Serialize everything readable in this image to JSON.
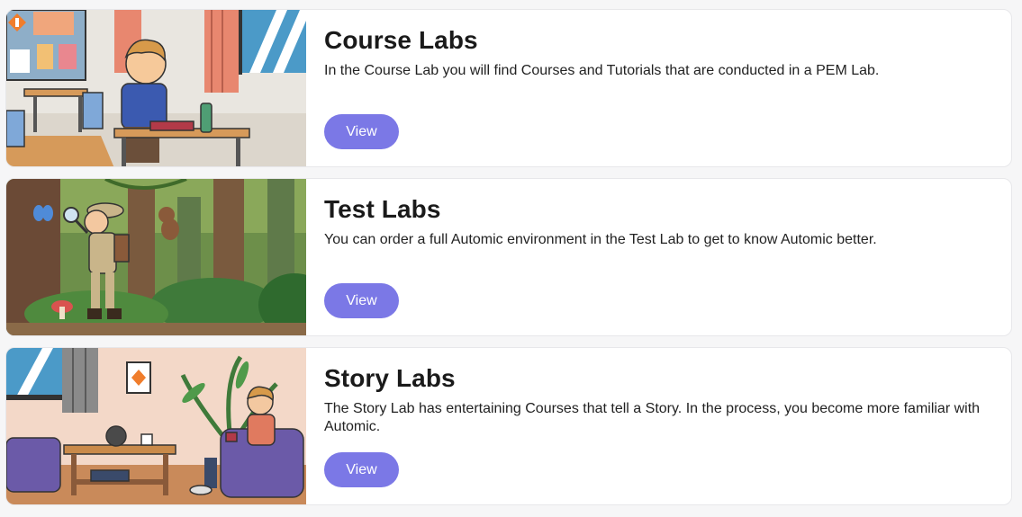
{
  "labs": [
    {
      "title": "Course Labs",
      "description": "In the Course Lab you will find Courses and Tutorials that are conducted in a PEM Lab.",
      "button_label": "View",
      "image": "classroom-illustration"
    },
    {
      "title": "Test Labs",
      "description": "You can order a full Automic environment in the Test Lab to get to know Automic better.",
      "button_label": "View",
      "image": "jungle-explorer-illustration"
    },
    {
      "title": "Story Labs",
      "description": "The Story Lab has entertaining Courses that tell a Story. In the process, you become more familiar with Automic.",
      "button_label": "View",
      "image": "living-room-reader-illustration"
    }
  ],
  "colors": {
    "button": "#7b78e6",
    "background": "#f6f6f7",
    "card": "#ffffff"
  }
}
